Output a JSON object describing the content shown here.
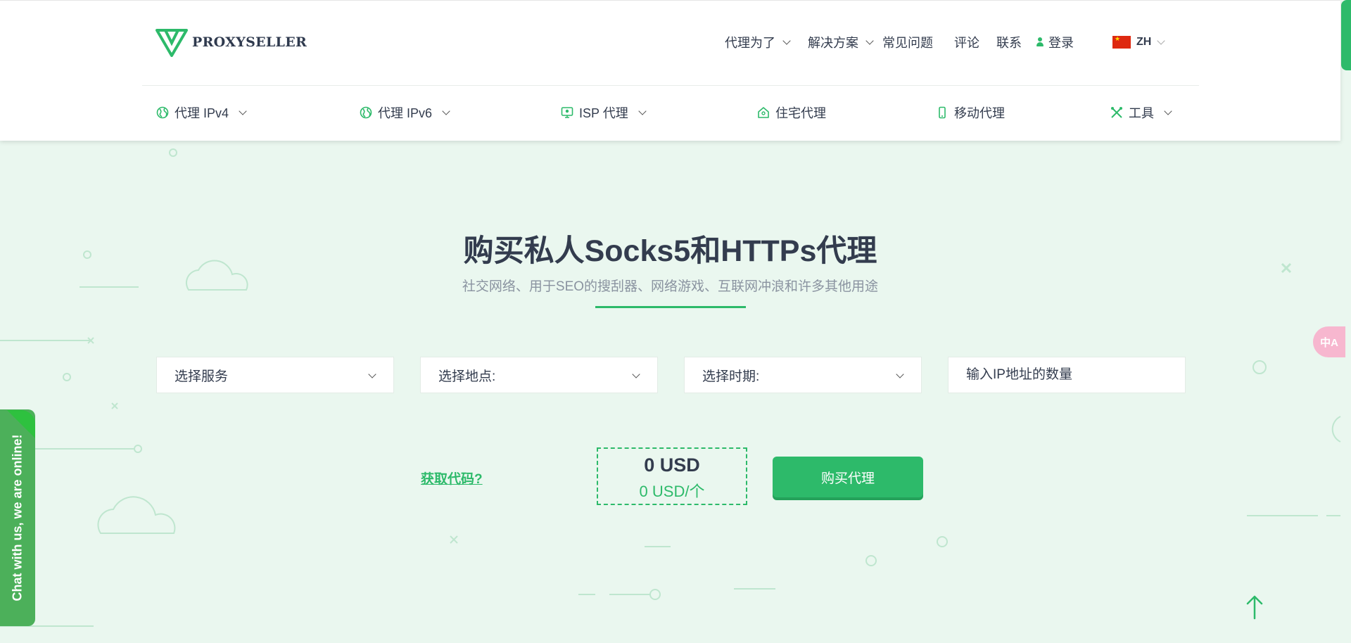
{
  "logo": {
    "text": "PROXYSELLER",
    "icon": "proxyseller-logo-icon"
  },
  "topnav": {
    "proxy_for": "代理为了",
    "solutions": "解决方案",
    "faq": "常见问题",
    "reviews": "评论",
    "contact": "联系",
    "login": "登录",
    "lang": "ZH"
  },
  "subnav": {
    "ipv4": "代理 IPv4",
    "ipv6": "代理 IPv6",
    "isp": "ISP 代理",
    "residential": "住宅代理",
    "mobile": "移动代理",
    "tools": "工具"
  },
  "hero": {
    "title": "购买私人Socks5和HTTPs代理",
    "subtitle": "社交网络、用于SEO的搜刮器、网络游戏、互联网冲浪和许多其他用途"
  },
  "form": {
    "service": "选择服务",
    "location": "选择地点:",
    "period": "选择时期:",
    "quantity_placeholder": "输入IP地址的数量"
  },
  "order": {
    "promo": "获取代码?",
    "total": "0 USD",
    "per_unit": "0 USD/个",
    "buy": "购买代理"
  },
  "chat": {
    "label": "Chat with us, we are online!"
  },
  "translate": {
    "label": "中A"
  },
  "colors": {
    "accent": "#2dba6a",
    "background": "#eaf7ef",
    "text": "#333c4e"
  }
}
